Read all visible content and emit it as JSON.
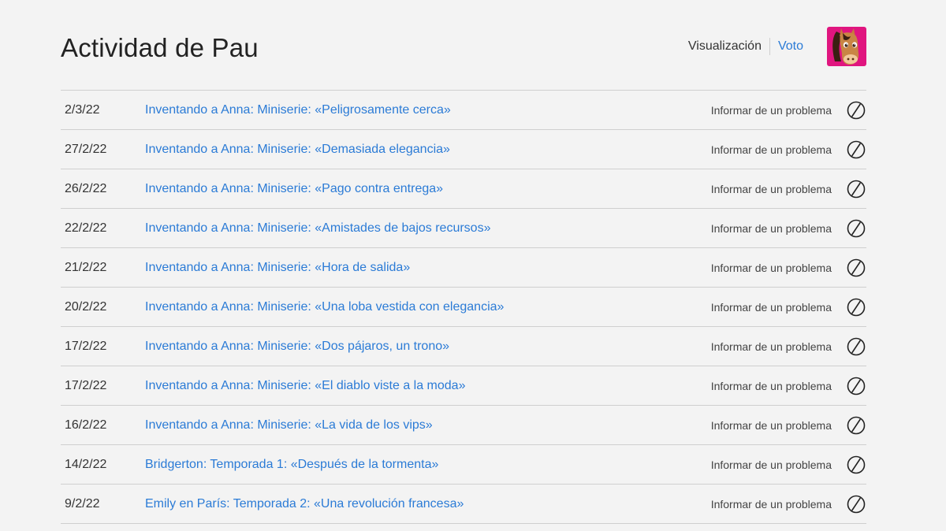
{
  "page": {
    "title": "Actividad de Pau"
  },
  "view_switch": {
    "viewing_label": "Visualización",
    "rating_label": "Voto",
    "active_color": "#2b7bd6"
  },
  "profile": {
    "avatar_icon": "horse-avatar-icon",
    "avatar_background": "#e0157f"
  },
  "rows": [
    {
      "date": "2/3/22",
      "title": "Inventando a Anna: Miniserie: «Peligrosamente cerca»",
      "report": "Informar de un problema",
      "icon": "hide-icon"
    },
    {
      "date": "27/2/22",
      "title": "Inventando a Anna: Miniserie: «Demasiada elegancia»",
      "report": "Informar de un problema",
      "icon": "hide-icon"
    },
    {
      "date": "26/2/22",
      "title": "Inventando a Anna: Miniserie: «Pago contra entrega»",
      "report": "Informar de un problema",
      "icon": "hide-icon"
    },
    {
      "date": "22/2/22",
      "title": "Inventando a Anna: Miniserie: «Amistades de bajos recursos»",
      "report": "Informar de un problema",
      "icon": "hide-icon"
    },
    {
      "date": "21/2/22",
      "title": "Inventando a Anna: Miniserie: «Hora de salida»",
      "report": "Informar de un problema",
      "icon": "hide-icon"
    },
    {
      "date": "20/2/22",
      "title": "Inventando a Anna: Miniserie: «Una loba vestida con elegancia»",
      "report": "Informar de un problema",
      "icon": "hide-icon"
    },
    {
      "date": "17/2/22",
      "title": "Inventando a Anna: Miniserie: «Dos pájaros, un trono»",
      "report": "Informar de un problema",
      "icon": "hide-icon"
    },
    {
      "date": "17/2/22",
      "title": "Inventando a Anna: Miniserie: «El diablo viste a la moda»",
      "report": "Informar de un problema",
      "icon": "hide-icon"
    },
    {
      "date": "16/2/22",
      "title": "Inventando a Anna: Miniserie: «La vida de los vips»",
      "report": "Informar de un problema",
      "icon": "hide-icon"
    },
    {
      "date": "14/2/22",
      "title": "Bridgerton: Temporada 1: «Después de la tormenta»",
      "report": "Informar de un problema",
      "icon": "hide-icon"
    },
    {
      "date": "9/2/22",
      "title": "Emily en París: Temporada 2: «Una revolución francesa»",
      "report": "Informar de un problema",
      "icon": "hide-icon"
    }
  ]
}
